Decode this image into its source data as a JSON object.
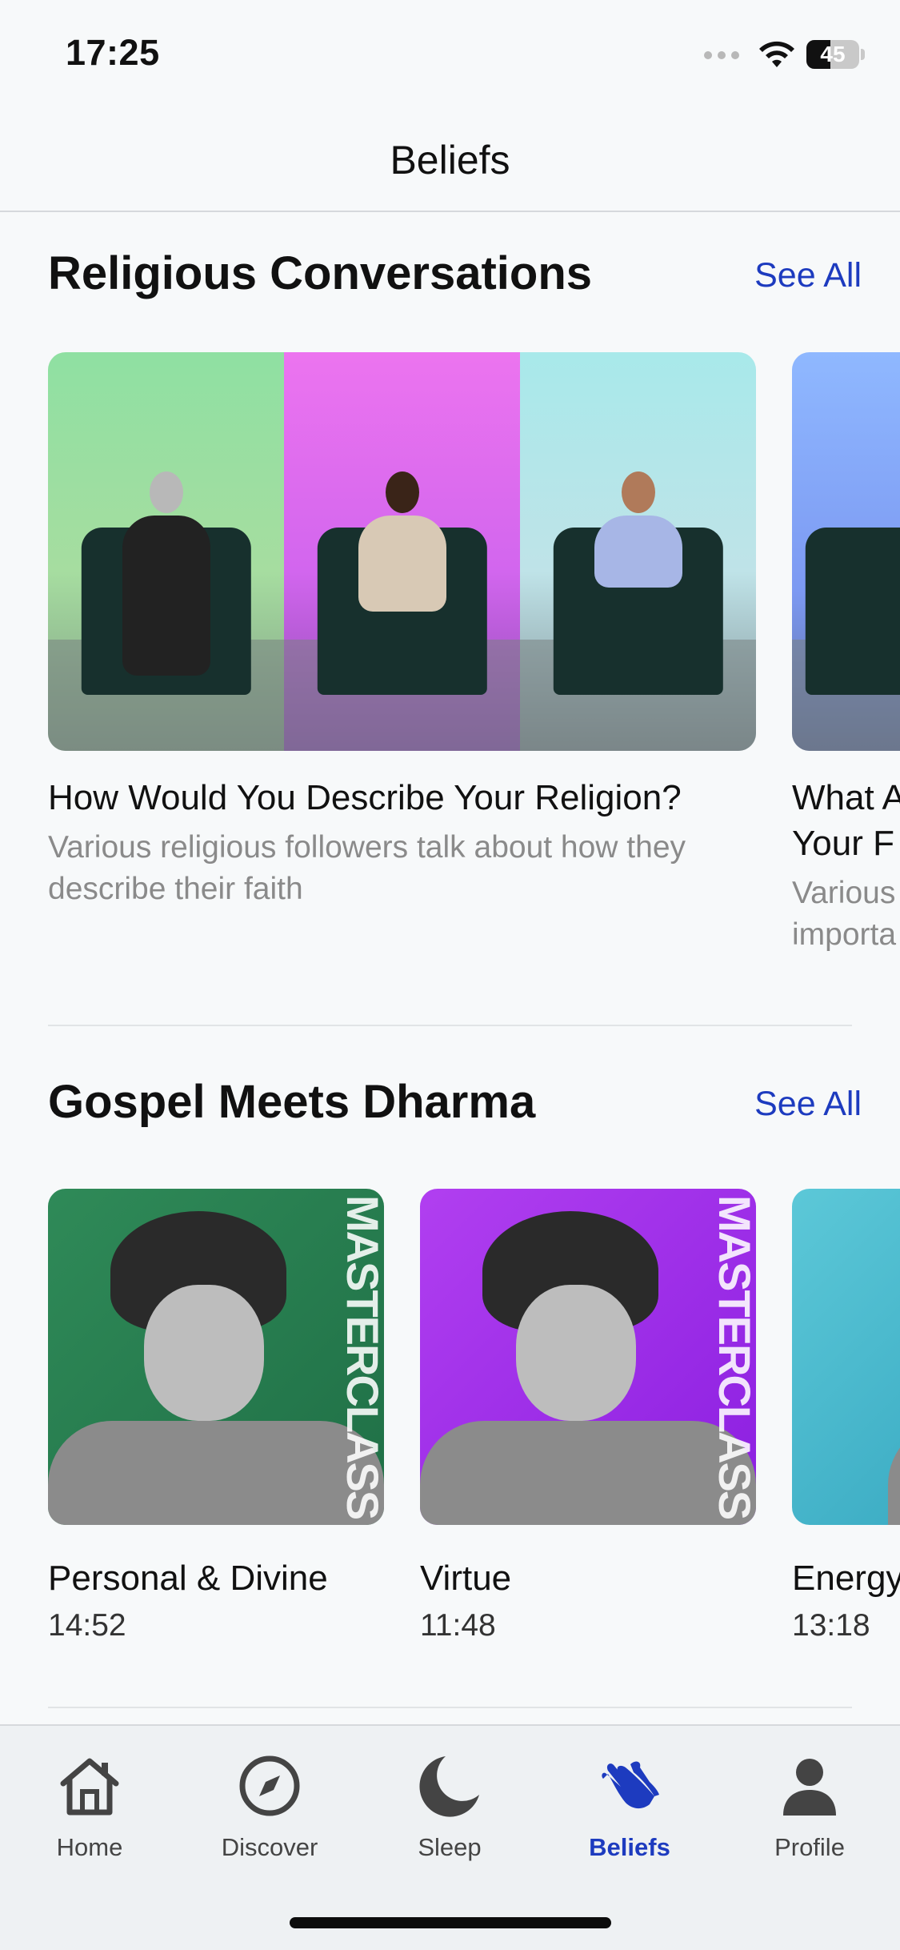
{
  "status_bar": {
    "time": "17:25",
    "battery": "45",
    "battery_level": 0.45
  },
  "header": {
    "title": "Beliefs"
  },
  "sections": [
    {
      "title": "Religious Conversations",
      "see_all": "See All",
      "cards": [
        {
          "title": "How Would You Describe Your Religion?",
          "description": "Various religious followers talk about how they describe their faith"
        },
        {
          "title_line1": "What A",
          "title_line2": "Your F",
          "desc_line1": "Various",
          "desc_line2": "importa"
        }
      ]
    },
    {
      "title": "Gospel Meets Dharma",
      "see_all": "See All",
      "cards": [
        {
          "title": "Personal & Divine",
          "duration": "14:52",
          "badge": "MASTERCLASS"
        },
        {
          "title": "Virtue",
          "duration": "11:48",
          "badge": "MASTERCLASS"
        },
        {
          "title": "Energy",
          "duration": "13:18"
        }
      ]
    }
  ],
  "tab_bar": [
    {
      "label": "Home",
      "icon": "home-icon"
    },
    {
      "label": "Discover",
      "icon": "compass-icon"
    },
    {
      "label": "Sleep",
      "icon": "moon-icon"
    },
    {
      "label": "Beliefs",
      "icon": "praying-hands-icon",
      "active": true
    },
    {
      "label": "Profile",
      "icon": "person-icon"
    }
  ],
  "colors": {
    "accent": "#1d3bbf",
    "background": "#f7f9fa"
  }
}
